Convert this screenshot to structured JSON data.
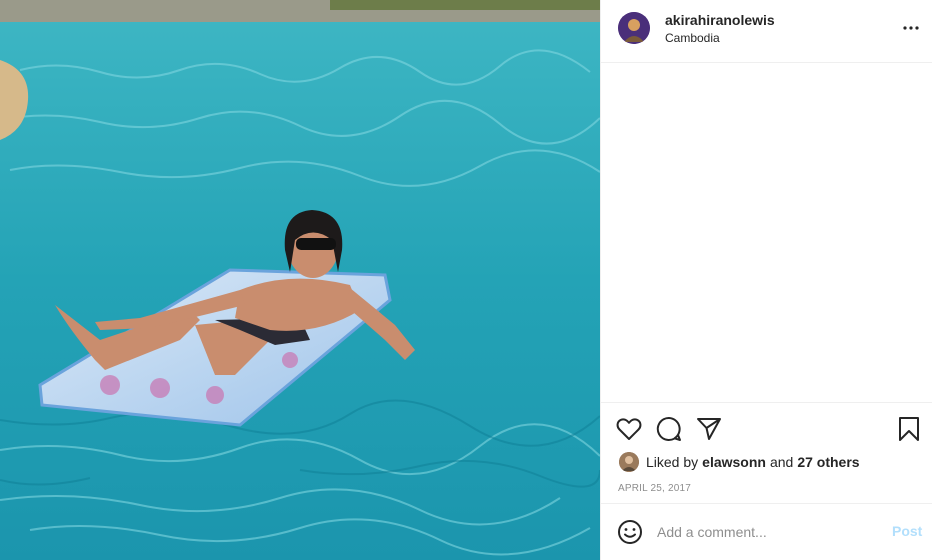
{
  "photo": {
    "alt_subject": "pool-float-photo",
    "water_color": "#2aa7b8"
  },
  "header": {
    "username": "akirahiranolewis",
    "location": "Cambodia",
    "avatar_icon": "profile-avatar",
    "more_icon": "more-options-icon"
  },
  "actions": {
    "like_icon": "heart-icon",
    "comment_icon": "comment-icon",
    "share_icon": "paper-plane-icon",
    "save_icon": "bookmark-icon"
  },
  "likes": {
    "prefix": "Liked by",
    "user": "elawsonn",
    "conjunction": "and",
    "others": "27 others"
  },
  "post_date": "April 25, 2017",
  "comment_box": {
    "placeholder": "Add a comment...",
    "post_label": "Post",
    "post_color": "#b2dffc",
    "emoji_icon": "smiley-icon"
  },
  "colors": {
    "text": "#262626",
    "muted": "#8e8e8e",
    "border": "#efefef"
  }
}
